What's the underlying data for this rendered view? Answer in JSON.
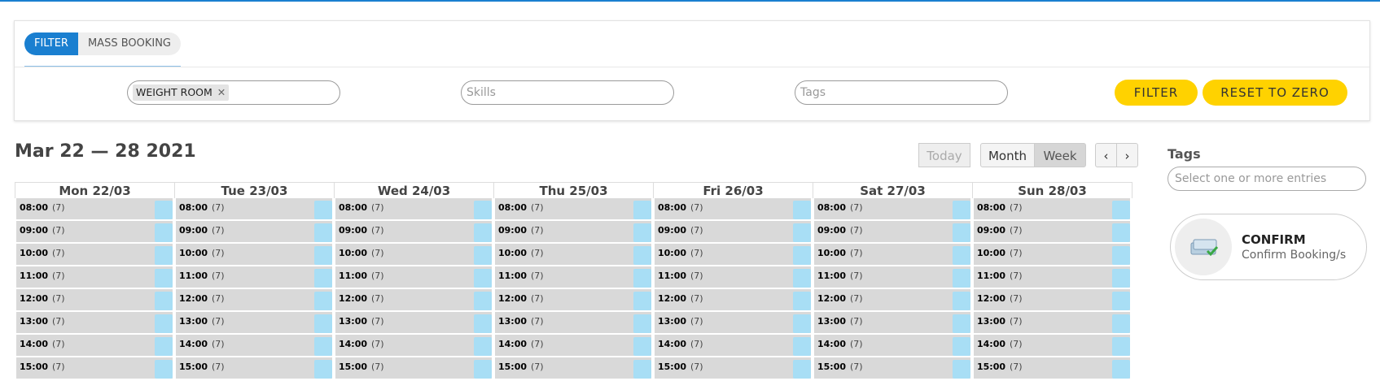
{
  "filter_panel": {
    "tabs": [
      {
        "label": "FILTER",
        "active": true
      },
      {
        "label": "MASS BOOKING",
        "active": false
      }
    ],
    "room_chip": "WEIGHT ROOM",
    "skills_placeholder": "Skills",
    "tags_placeholder": "Tags",
    "filter_button": "FILTER",
    "reset_button": "RESET TO ZERO"
  },
  "calendar": {
    "title": "Mar 22 — 28 2021",
    "today_button": "Today",
    "month_button": "Month",
    "week_button": "Week",
    "prev_icon": "‹",
    "next_icon": "›",
    "days": [
      {
        "label": "Mon 22/03"
      },
      {
        "label": "Tue 23/03"
      },
      {
        "label": "Wed 24/03"
      },
      {
        "label": "Thu 25/03"
      },
      {
        "label": "Fri 26/03"
      },
      {
        "label": "Sat 27/03"
      },
      {
        "label": "Sun 28/03"
      }
    ],
    "slots": [
      {
        "time": "08:00",
        "count": "(7)"
      },
      {
        "time": "09:00",
        "count": "(7)"
      },
      {
        "time": "10:00",
        "count": "(7)"
      },
      {
        "time": "11:00",
        "count": "(7)"
      },
      {
        "time": "12:00",
        "count": "(7)"
      },
      {
        "time": "13:00",
        "count": "(7)"
      },
      {
        "time": "14:00",
        "count": "(7)"
      },
      {
        "time": "15:00",
        "count": "(7)"
      }
    ]
  },
  "sidebar": {
    "tags_label": "Tags",
    "tags_placeholder": "Select one or more entries",
    "confirm_title": "CONFIRM",
    "confirm_subtitle": "Confirm Booking/s",
    "confirm_icon": "booking-confirm-icon"
  },
  "colors": {
    "accent": "#1a7fd0",
    "button_yellow": "#ffd200",
    "slot_grey": "#d9d9d9",
    "slot_available": "#a8def5"
  }
}
